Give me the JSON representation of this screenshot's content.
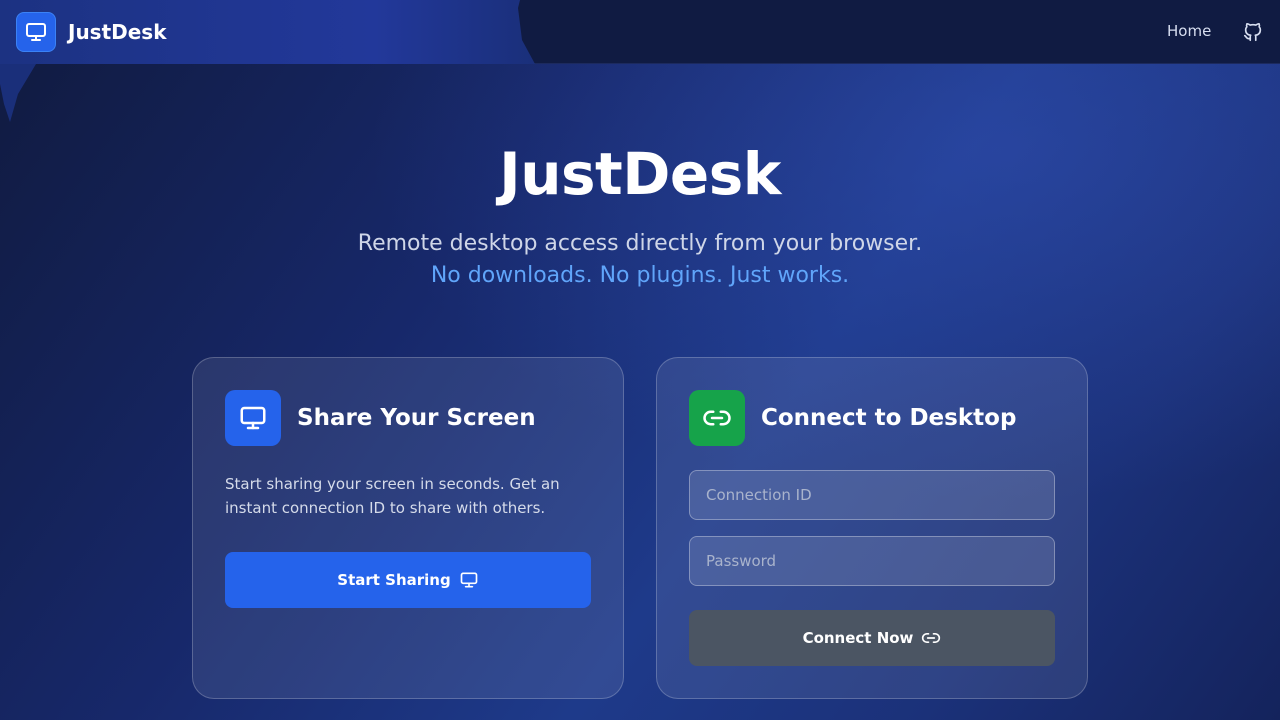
{
  "navbar": {
    "brand_name": "JustDesk",
    "brand_icon": "monitor-icon",
    "links": {
      "home": "Home"
    },
    "github_icon": "github-icon"
  },
  "hero": {
    "title": "JustDesk",
    "subtitle": "Remote desktop access directly from your browser.",
    "tagline": "No downloads. No plugins. Just works."
  },
  "share_card": {
    "title": "Share Your Screen",
    "icon": "monitor-icon",
    "description": "Start sharing your screen in seconds. Get an instant connection ID to share with others.",
    "button_label": "Start Sharing",
    "button_icon": "monitor-icon"
  },
  "connect_card": {
    "title": "Connect to Desktop",
    "icon": "link-icon",
    "connection_id": {
      "placeholder": "Connection ID",
      "value": ""
    },
    "password": {
      "placeholder": "Password",
      "value": ""
    },
    "button_label": "Connect Now",
    "button_icon": "link-icon"
  },
  "colors": {
    "primary": "#2563eb",
    "success": "#16a34a",
    "accent_text": "#60a5fa",
    "disabled_button": "#4b5563"
  }
}
